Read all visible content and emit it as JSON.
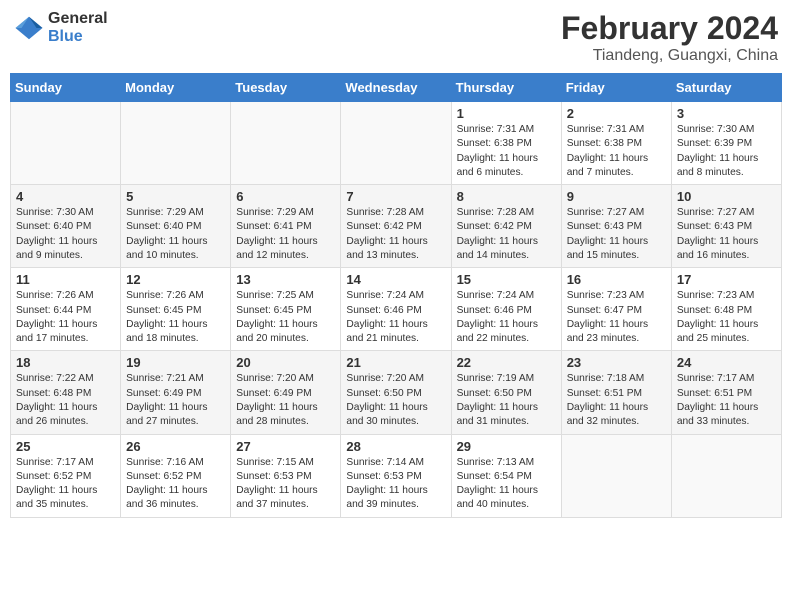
{
  "logo": {
    "general": "General",
    "blue": "Blue"
  },
  "title": "February 2024",
  "subtitle": "Tiandeng, Guangxi, China",
  "weekdays": [
    "Sunday",
    "Monday",
    "Tuesday",
    "Wednesday",
    "Thursday",
    "Friday",
    "Saturday"
  ],
  "weeks": [
    [
      {
        "day": "",
        "info": ""
      },
      {
        "day": "",
        "info": ""
      },
      {
        "day": "",
        "info": ""
      },
      {
        "day": "",
        "info": ""
      },
      {
        "day": "1",
        "info": "Sunrise: 7:31 AM\nSunset: 6:38 PM\nDaylight: 11 hours and 6 minutes."
      },
      {
        "day": "2",
        "info": "Sunrise: 7:31 AM\nSunset: 6:38 PM\nDaylight: 11 hours and 7 minutes."
      },
      {
        "day": "3",
        "info": "Sunrise: 7:30 AM\nSunset: 6:39 PM\nDaylight: 11 hours and 8 minutes."
      }
    ],
    [
      {
        "day": "4",
        "info": "Sunrise: 7:30 AM\nSunset: 6:40 PM\nDaylight: 11 hours and 9 minutes."
      },
      {
        "day": "5",
        "info": "Sunrise: 7:29 AM\nSunset: 6:40 PM\nDaylight: 11 hours and 10 minutes."
      },
      {
        "day": "6",
        "info": "Sunrise: 7:29 AM\nSunset: 6:41 PM\nDaylight: 11 hours and 12 minutes."
      },
      {
        "day": "7",
        "info": "Sunrise: 7:28 AM\nSunset: 6:42 PM\nDaylight: 11 hours and 13 minutes."
      },
      {
        "day": "8",
        "info": "Sunrise: 7:28 AM\nSunset: 6:42 PM\nDaylight: 11 hours and 14 minutes."
      },
      {
        "day": "9",
        "info": "Sunrise: 7:27 AM\nSunset: 6:43 PM\nDaylight: 11 hours and 15 minutes."
      },
      {
        "day": "10",
        "info": "Sunrise: 7:27 AM\nSunset: 6:43 PM\nDaylight: 11 hours and 16 minutes."
      }
    ],
    [
      {
        "day": "11",
        "info": "Sunrise: 7:26 AM\nSunset: 6:44 PM\nDaylight: 11 hours and 17 minutes."
      },
      {
        "day": "12",
        "info": "Sunrise: 7:26 AM\nSunset: 6:45 PM\nDaylight: 11 hours and 18 minutes."
      },
      {
        "day": "13",
        "info": "Sunrise: 7:25 AM\nSunset: 6:45 PM\nDaylight: 11 hours and 20 minutes."
      },
      {
        "day": "14",
        "info": "Sunrise: 7:24 AM\nSunset: 6:46 PM\nDaylight: 11 hours and 21 minutes."
      },
      {
        "day": "15",
        "info": "Sunrise: 7:24 AM\nSunset: 6:46 PM\nDaylight: 11 hours and 22 minutes."
      },
      {
        "day": "16",
        "info": "Sunrise: 7:23 AM\nSunset: 6:47 PM\nDaylight: 11 hours and 23 minutes."
      },
      {
        "day": "17",
        "info": "Sunrise: 7:23 AM\nSunset: 6:48 PM\nDaylight: 11 hours and 25 minutes."
      }
    ],
    [
      {
        "day": "18",
        "info": "Sunrise: 7:22 AM\nSunset: 6:48 PM\nDaylight: 11 hours and 26 minutes."
      },
      {
        "day": "19",
        "info": "Sunrise: 7:21 AM\nSunset: 6:49 PM\nDaylight: 11 hours and 27 minutes."
      },
      {
        "day": "20",
        "info": "Sunrise: 7:20 AM\nSunset: 6:49 PM\nDaylight: 11 hours and 28 minutes."
      },
      {
        "day": "21",
        "info": "Sunrise: 7:20 AM\nSunset: 6:50 PM\nDaylight: 11 hours and 30 minutes."
      },
      {
        "day": "22",
        "info": "Sunrise: 7:19 AM\nSunset: 6:50 PM\nDaylight: 11 hours and 31 minutes."
      },
      {
        "day": "23",
        "info": "Sunrise: 7:18 AM\nSunset: 6:51 PM\nDaylight: 11 hours and 32 minutes."
      },
      {
        "day": "24",
        "info": "Sunrise: 7:17 AM\nSunset: 6:51 PM\nDaylight: 11 hours and 33 minutes."
      }
    ],
    [
      {
        "day": "25",
        "info": "Sunrise: 7:17 AM\nSunset: 6:52 PM\nDaylight: 11 hours and 35 minutes."
      },
      {
        "day": "26",
        "info": "Sunrise: 7:16 AM\nSunset: 6:52 PM\nDaylight: 11 hours and 36 minutes."
      },
      {
        "day": "27",
        "info": "Sunrise: 7:15 AM\nSunset: 6:53 PM\nDaylight: 11 hours and 37 minutes."
      },
      {
        "day": "28",
        "info": "Sunrise: 7:14 AM\nSunset: 6:53 PM\nDaylight: 11 hours and 39 minutes."
      },
      {
        "day": "29",
        "info": "Sunrise: 7:13 AM\nSunset: 6:54 PM\nDaylight: 11 hours and 40 minutes."
      },
      {
        "day": "",
        "info": ""
      },
      {
        "day": "",
        "info": ""
      }
    ]
  ]
}
